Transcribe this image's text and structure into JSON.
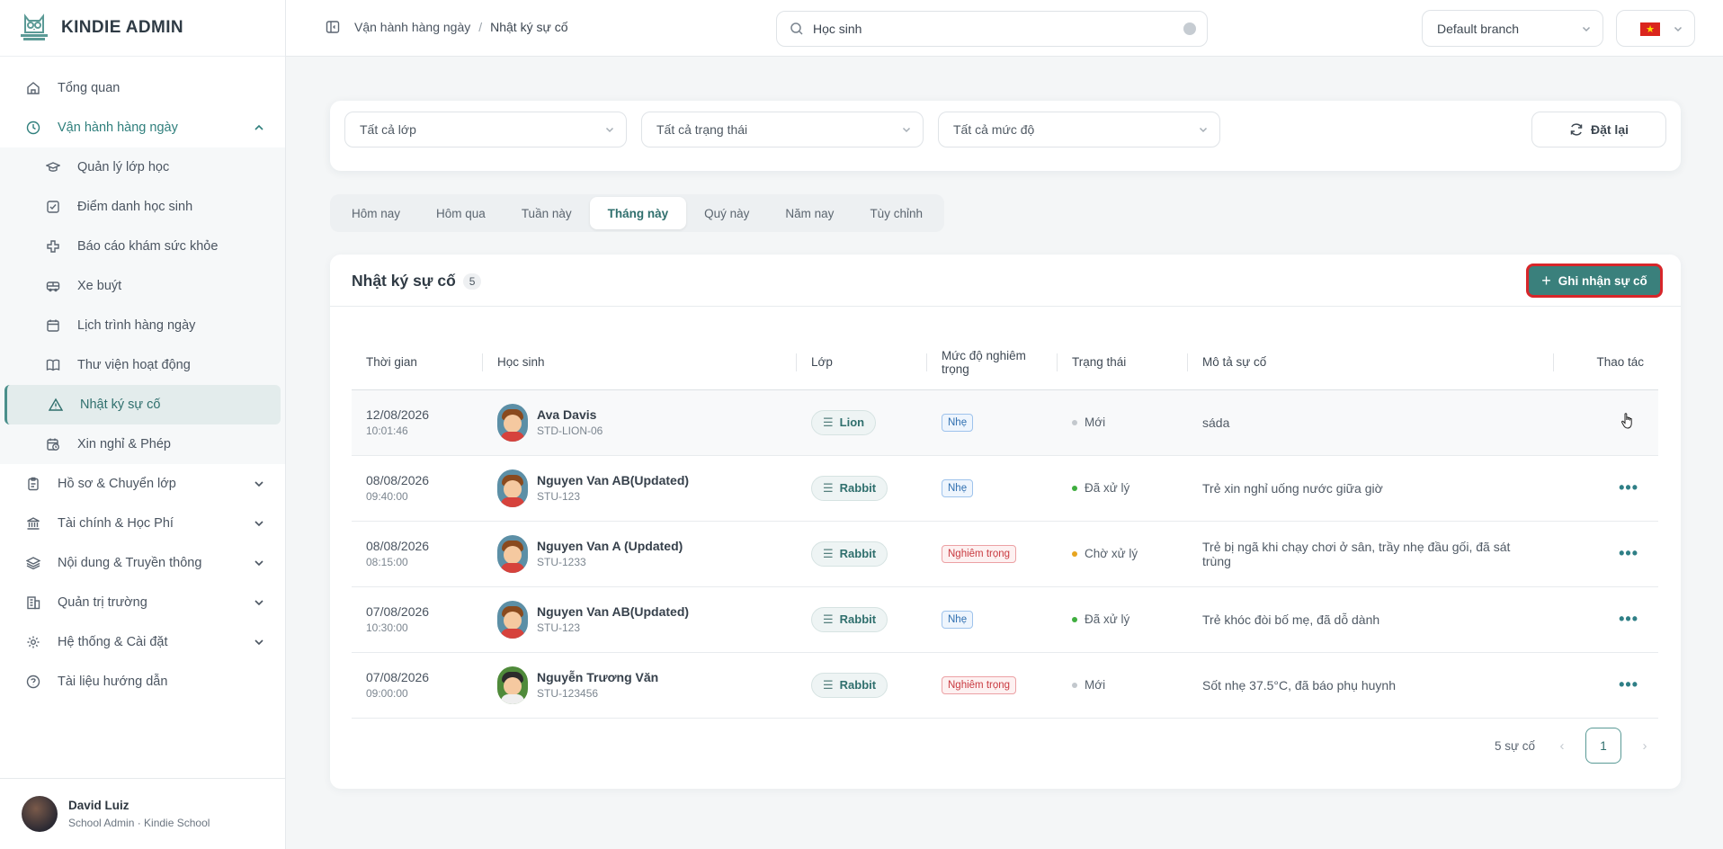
{
  "brand": {
    "name": "KINDIE ADMIN"
  },
  "sidebar": {
    "items": [
      {
        "label": "Tổng quan",
        "icon": "home-icon"
      },
      {
        "label": "Vận hành hàng ngày",
        "icon": "clock-icon"
      },
      {
        "label": "Hồ sơ & Chuyển lớp",
        "icon": "clipboard-icon"
      },
      {
        "label": "Tài chính & Học Phí",
        "icon": "bank-icon"
      },
      {
        "label": "Nội dung & Truyền thông",
        "icon": "layers-icon"
      },
      {
        "label": "Quản trị trường",
        "icon": "building-icon"
      },
      {
        "label": "Hệ thống & Cài đặt",
        "icon": "gear-icon"
      },
      {
        "label": "Tài liệu hướng dẫn",
        "icon": "help-circle-icon"
      }
    ],
    "sub_items": [
      {
        "label": "Quản lý lớp học",
        "icon": "graduation-cap-icon"
      },
      {
        "label": "Điểm danh học sinh",
        "icon": "checkbox-icon"
      },
      {
        "label": "Báo cáo khám sức khỏe",
        "icon": "health-cross-icon"
      },
      {
        "label": "Xe buýt",
        "icon": "bus-icon"
      },
      {
        "label": "Lịch trình hàng ngày",
        "icon": "calendar-icon"
      },
      {
        "label": "Thư viện hoạt động",
        "icon": "book-icon"
      },
      {
        "label": "Nhật ký sự cố",
        "icon": "warning-icon"
      },
      {
        "label": "Xin nghỉ & Phép",
        "icon": "calendar-clock-icon"
      }
    ]
  },
  "user": {
    "name": "David Luiz",
    "role": "School Admin · Kindie School"
  },
  "topbar": {
    "breadcrumb_parent": "Vận hành hàng ngày",
    "breadcrumb_sep": "/",
    "breadcrumb_current": "Nhật ký sự cố",
    "search_placeholder": "Học sinh",
    "search_value": "Học sinh",
    "branch": "Default branch",
    "flag_star": "★"
  },
  "filters": {
    "class": "Tất cả lớp",
    "status": "Tất cả trạng thái",
    "severity": "Tất cả mức độ",
    "reset_label": "Đặt lại"
  },
  "tabs": [
    "Hôm nay",
    "Hôm qua",
    "Tuần này",
    "Tháng này",
    "Quý này",
    "Năm nay",
    "Tùy chỉnh"
  ],
  "active_tab": "Tháng này",
  "card": {
    "title": "Nhật ký sự cố",
    "count": "5",
    "add_button": "Ghi nhận sự cố",
    "add_plus": "+"
  },
  "table": {
    "headers": [
      "Thời gian",
      "Học sinh",
      "Lớp",
      "Mức độ nghiêm trọng",
      "Trạng thái",
      "Mô tả sự cố",
      "Thao tác"
    ],
    "rows": [
      {
        "date": "12/08/2026",
        "time": "10:01:46",
        "name": "Ava Davis",
        "id": "STD-LION-06",
        "class": "Lion",
        "severity": "Nhẹ",
        "status": "Mới",
        "description": "sáda"
      },
      {
        "date": "08/08/2026",
        "time": "09:40:00",
        "name": "Nguyen Van AB(Updated)",
        "id": "STU-123",
        "class": "Rabbit",
        "severity": "Nhẹ",
        "status": "Đã xử lý",
        "description": "Trẻ xin nghỉ uống nước giữa giờ"
      },
      {
        "date": "08/08/2026",
        "time": "08:15:00",
        "name": "Nguyen Van A (Updated)",
        "id": "STU-1233",
        "class": "Rabbit",
        "severity": "Nghiêm trọng",
        "status": "Chờ xử lý",
        "description": "Trẻ bị ngã khi chạy chơi ở sân, trầy nhẹ đầu gối, đã sát trùng"
      },
      {
        "date": "07/08/2026",
        "time": "10:30:00",
        "name": "Nguyen Van AB(Updated)",
        "id": "STU-123",
        "class": "Rabbit",
        "severity": "Nhẹ",
        "status": "Đã xử lý",
        "description": "Trẻ khóc đòi bố mẹ, đã dỗ dành"
      },
      {
        "date": "07/08/2026",
        "time": "09:00:00",
        "name": "Nguyễn Trương Văn",
        "id": "STU-123456",
        "class": "Rabbit",
        "severity": "Nghiêm trọng",
        "status": "Mới",
        "description": "Sốt nhẹ 37.5°C, đã báo phụ huynh"
      }
    ],
    "more_glyph": "•••",
    "class_glyph": "☰"
  },
  "pager": {
    "total": "5 sự cố",
    "page": "1",
    "prev": "‹",
    "next": "›"
  },
  "colors": {
    "primary": "#3a807c",
    "active_bg": "#e3ecec",
    "severity_light": "#2f6fb0",
    "severity_severe": "#c93a40",
    "status_done": "#3fae3f",
    "status_wait": "#e7a520",
    "status_new": "#c3c8cd"
  }
}
